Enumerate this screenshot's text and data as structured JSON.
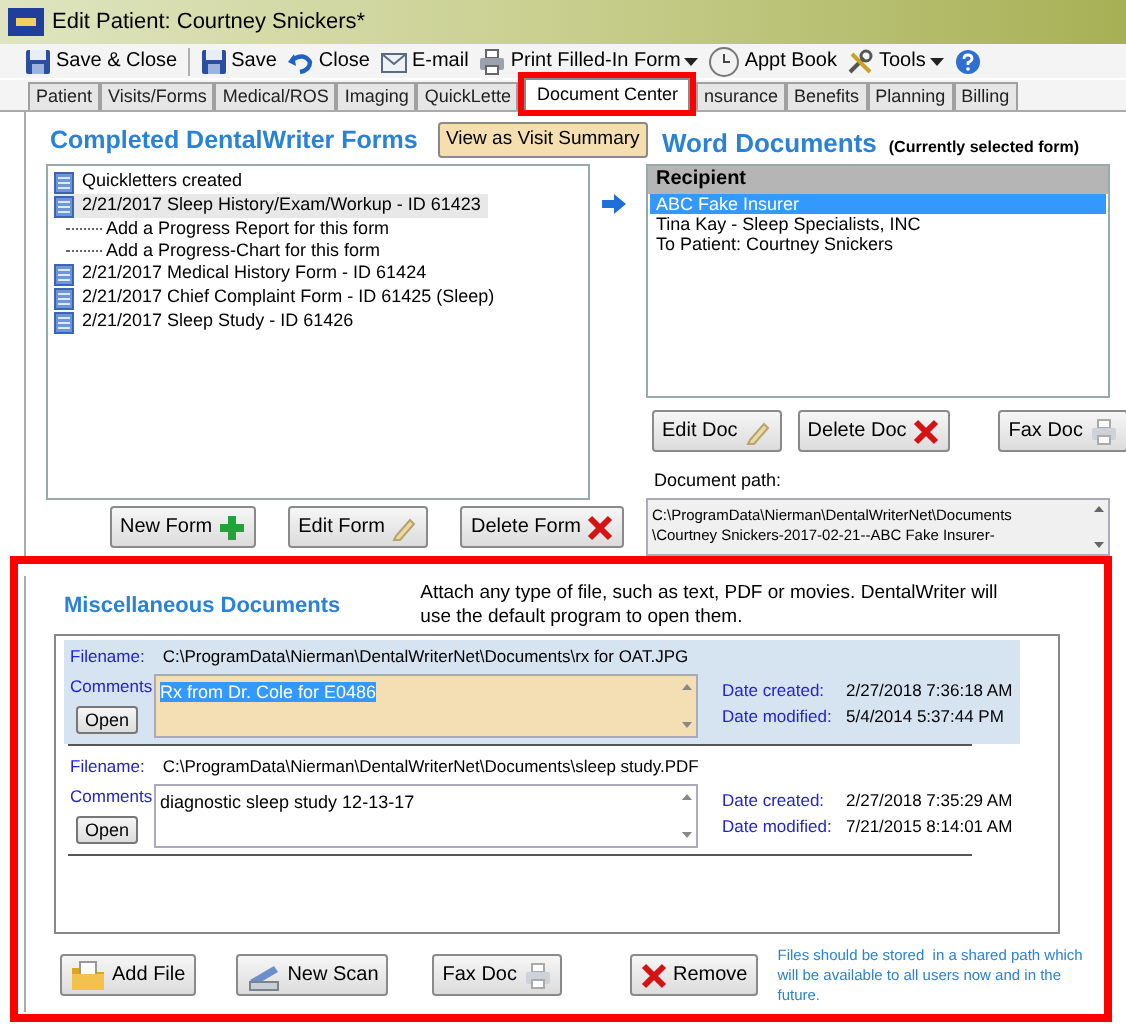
{
  "window": {
    "title": "Edit Patient: Courtney Snickers*"
  },
  "toolbar": [
    {
      "label": "Save & Close",
      "kind": "save"
    },
    {
      "kind": "separator"
    },
    {
      "label": "Save",
      "kind": "save"
    },
    {
      "label": "Close",
      "kind": "undo"
    },
    {
      "label": "E-mail",
      "kind": "mail"
    },
    {
      "label": "Print Filled-In Form",
      "kind": "print",
      "dropdown": true
    },
    {
      "label": "Appt Book",
      "kind": "clock"
    },
    {
      "label": "Tools",
      "kind": "tools",
      "dropdown": true
    },
    {
      "kind": "help"
    }
  ],
  "tabs": [
    {
      "label": "Patient",
      "selected": false
    },
    {
      "label": "Visits/Forms",
      "selected": false
    },
    {
      "label": "Medical/ROS",
      "selected": false
    },
    {
      "label": "Imaging",
      "selected": false
    },
    {
      "label": "QuickLette",
      "selected": false
    },
    {
      "label": "Document Center",
      "selected": true
    },
    {
      "label": "nsurance",
      "selected": false
    },
    {
      "label": "Benefits",
      "selected": false
    },
    {
      "label": "Planning",
      "selected": false
    },
    {
      "label": "Billing",
      "selected": false
    }
  ],
  "forms": {
    "title": "Completed DentalWriter Forms",
    "view_button": "View as Visit Summary",
    "items": [
      {
        "label": "Quickletters created",
        "selected": false
      },
      {
        "label": "2/21/2017 Sleep History/Exam/Workup - ID 61423",
        "selected": true,
        "children": [
          {
            "label": "Add a Progress Report for this form"
          },
          {
            "label": "Add a Progress-Chart for this form"
          }
        ]
      },
      {
        "label": "2/21/2017 Medical History Form - ID 61424",
        "selected": false
      },
      {
        "label": "2/21/2017 Chief Complaint Form - ID 61425 (Sleep)",
        "selected": false
      },
      {
        "label": "2/21/2017 Sleep Study - ID 61426",
        "selected": false
      }
    ],
    "buttons": [
      {
        "label": "New Form",
        "kind": "add"
      },
      {
        "label": "Edit Form",
        "kind": "edit"
      },
      {
        "label": "Delete Form",
        "kind": "delete"
      }
    ]
  },
  "word_documents": {
    "title": "Word Documents",
    "note": "(Currently selected form)",
    "column": "Recipient",
    "recipients": [
      {
        "label": "ABC Fake Insurer",
        "selected": true
      },
      {
        "label": "Tina Kay - Sleep Specialists, INC",
        "selected": false
      },
      {
        "label": "To Patient: Courtney Snickers",
        "selected": false
      }
    ],
    "buttons": [
      {
        "label": "Edit Doc",
        "kind": "edit"
      },
      {
        "label": "Delete Doc",
        "kind": "delete"
      },
      {
        "label": "Fax Doc",
        "kind": "fax"
      }
    ],
    "path_label": "Document path:",
    "path": "C:\\ProgramData\\Nierman\\DentalWriterNet\\Documents\n\\Courtney Snickers-2017-02-21--ABC Fake Insurer-"
  },
  "misc": {
    "title": "Miscellaneous Documents",
    "note": "Attach any type of file, such as text, PDF or movies. DentalWriter will use the default program to open them.",
    "files": [
      {
        "selected": true,
        "comment_selected": true,
        "filename_label": "Filename:",
        "filename": "C:\\ProgramData\\Nierman\\DentalWriterNet\\Documents\\rx for OAT.JPG",
        "comments_label": "Comments",
        "comment": "Rx from Dr. Cole for E0486",
        "open": "Open",
        "created_label": "Date created:",
        "created": "2/27/2018 7:36:18 AM",
        "modified_label": "Date modified:",
        "modified": "5/4/2014 5:37:44 PM"
      },
      {
        "selected": false,
        "comment_selected": false,
        "filename_label": "Filename:",
        "filename": "C:\\ProgramData\\Nierman\\DentalWriterNet\\Documents\\sleep study.PDF",
        "comments_label": "Comments",
        "comment": "diagnostic sleep study 12-13-17",
        "open": "Open",
        "created_label": "Date created:",
        "created": "2/27/2018 7:35:29 AM",
        "modified_label": "Date modified:",
        "modified": "7/21/2015 8:14:01 AM"
      }
    ],
    "buttons": [
      {
        "label": "Add File",
        "kind": "folder"
      },
      {
        "label": "New Scan",
        "kind": "scan"
      },
      {
        "label": "Fax Doc",
        "kind": "fax"
      },
      {
        "label": "Remove",
        "kind": "delete"
      }
    ],
    "footer_note": "Files should be stored  in a shared path which will be available to all users now and in the future."
  }
}
